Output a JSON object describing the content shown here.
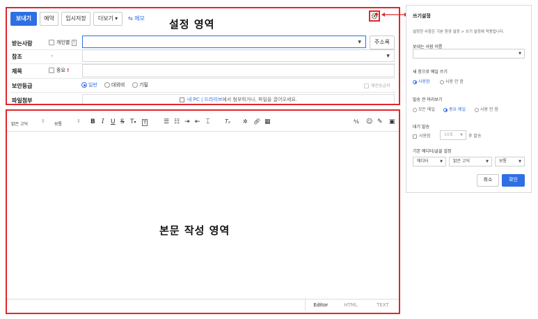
{
  "toolbar": {
    "send": "보내기",
    "reserve": "예약",
    "temp_save": "임시저장",
    "more": "더보기 ▾",
    "memo": "메모"
  },
  "annotations": {
    "settings_area": "설정 영역",
    "body_area": "본문 작성 영역"
  },
  "fields": {
    "to_label": "받는사람",
    "to_individual": "개인별",
    "to_help": "?",
    "addressbook": "주소록",
    "cc_label": "참조",
    "subject_label": "제목",
    "subject_important": "중요",
    "subject_important_mark": "!",
    "security_label": "보안등급",
    "security_options": [
      "일반",
      "대외비",
      "기밀"
    ],
    "security_selected": "일반",
    "forward_block": "재전송금지",
    "attach_label": "파일첨부",
    "attach_link": "내 PC | 드라이브",
    "attach_text": "에서 첨부하거나, 파일을 끌어오세요."
  },
  "editor": {
    "font": "맑은 고딕",
    "size": "보통",
    "tabs": [
      "Editor",
      "HTML",
      "TEXT"
    ],
    "active_tab": "Editor"
  },
  "panel": {
    "title": "쓰기설정",
    "description": "설정한 사항은 기본 환경 설정 > 쓰기 설정에 적용됩니다.",
    "sender_name_label": "보내는 사람 이름",
    "new_window_label": "새 창으로 메일 쓰기",
    "new_window_options": [
      "사용함",
      "사용 안 함"
    ],
    "new_window_selected": "사용함",
    "preview_label": "발송 전 미리보기",
    "preview_options": [
      "모든 메일",
      "중요 메일",
      "사용 안 함"
    ],
    "preview_selected": "중요 메일",
    "delay_label": "대기 발송",
    "delay_use": "사용함",
    "delay_value": "10초",
    "delay_suffix": "후 발송",
    "editor_font_label": "기본 에디터/글꼴 설정",
    "editor_select": "에디터",
    "font_select": "맑은 고딕",
    "size_select": "보통",
    "cancel": "취소",
    "confirm": "확인"
  },
  "colors": {
    "accent": "#2f6fe4",
    "annotation_red": "#e0262b"
  }
}
